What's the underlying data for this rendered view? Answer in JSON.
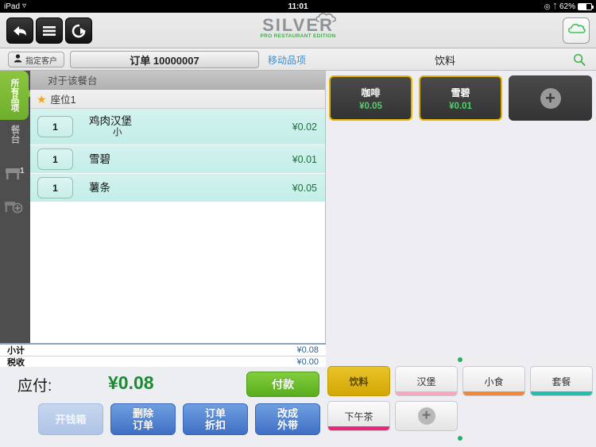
{
  "status_bar": {
    "device": "iPad",
    "wifi_icon": "wifi-icon",
    "time": "11:01",
    "location_icon": "location-icon",
    "bluetooth_icon": "bluetooth-icon",
    "battery_percent": "62%"
  },
  "toolbar": {
    "back_icon": "back-arrow-icon",
    "menu_icon": "hamburger-menu-icon",
    "logout_icon": "logout-icon",
    "cloud_icon": "cloud-icon",
    "logo_main": "SILVER",
    "logo_sub": "PRO RESTAURANT EDITION"
  },
  "subbar": {
    "customer_label": "指定客户",
    "customer_icon": "person-icon",
    "order_label": "订单 10000007",
    "move_items_label": "移动品项",
    "category_title": "饮料",
    "search_icon": "search-icon"
  },
  "rail": {
    "all_items_label": "所有品项",
    "table_label": "餐台",
    "table_icon": "table-icon",
    "table_badge": "1",
    "add_table_icon": "table-add-icon"
  },
  "order": {
    "header": "对于该餐台",
    "seat_label": "座位1",
    "seat_star_icon": "star-icon",
    "items": [
      {
        "qty": "1",
        "name": "鸡肉汉堡",
        "modifier": "小",
        "price": "¥0.02"
      },
      {
        "qty": "1",
        "name": "雪碧",
        "modifier": "",
        "price": "¥0.01"
      },
      {
        "qty": "1",
        "name": "薯条",
        "modifier": "",
        "price": "¥0.05"
      }
    ],
    "totals": [
      {
        "label": "小计",
        "value": "¥0.08"
      },
      {
        "label": "税收",
        "value": "¥0.00"
      }
    ],
    "due_label": "应付:",
    "due_amount": "¥0.08",
    "pay_label": "付款"
  },
  "actions": [
    {
      "line1": "开钱箱",
      "line2": "",
      "disabled": true
    },
    {
      "line1": "删除",
      "line2": "订单",
      "disabled": false
    },
    {
      "line1": "订单",
      "line2": "折扣",
      "disabled": false
    },
    {
      "line1": "改成",
      "line2": "外带",
      "disabled": false
    }
  ],
  "products": [
    {
      "name": "咖啡",
      "price": "¥0.05",
      "selected": true
    },
    {
      "name": "雪碧",
      "price": "¥0.01",
      "selected": true
    }
  ],
  "product_add_icon": "add-product-icon",
  "categories": [
    {
      "label": "饮料",
      "color": "#d3a806",
      "active": true
    },
    {
      "label": "汉堡",
      "color": "#f5a8c0",
      "active": false
    },
    {
      "label": "小食",
      "color": "#ef8a3c",
      "active": false
    },
    {
      "label": "套餐",
      "color": "#1fc0ae",
      "active": false
    },
    {
      "label": "下午茶",
      "color": "#e8277d",
      "active": false
    }
  ],
  "category_add_icon": "add-category-icon",
  "pagination": {
    "dot_color": "#2bae66"
  }
}
